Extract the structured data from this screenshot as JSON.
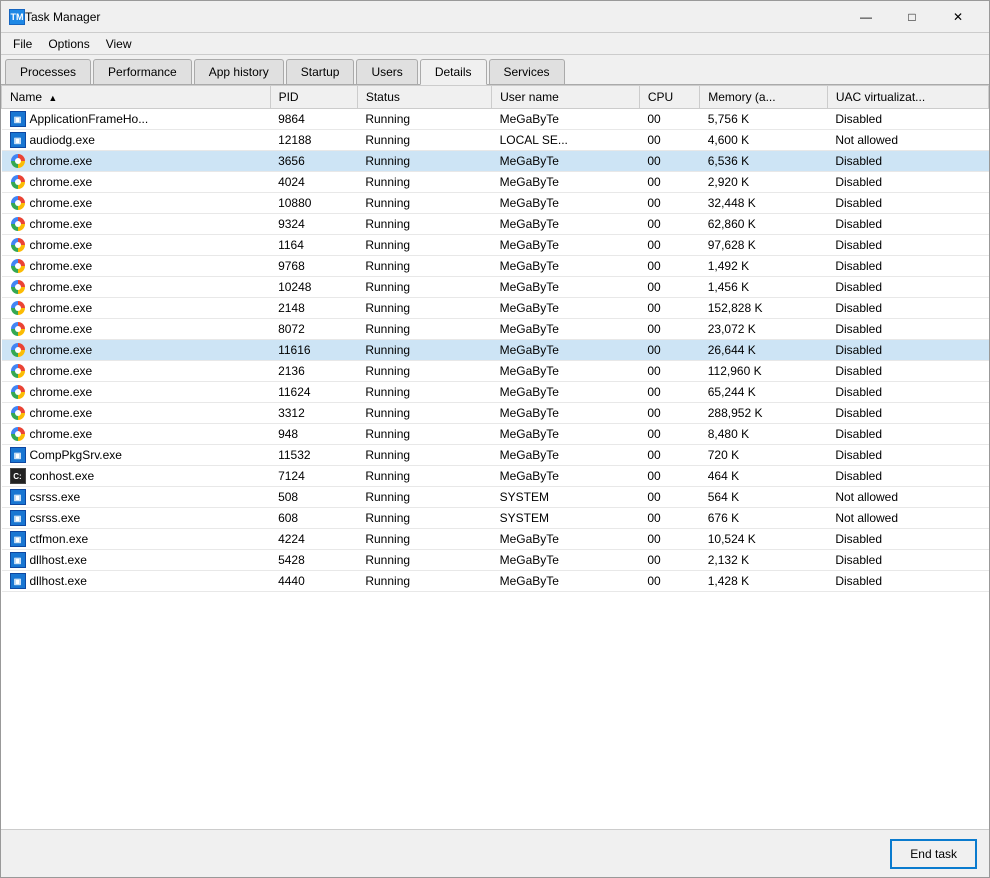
{
  "window": {
    "title": "Task Manager",
    "min_btn": "—",
    "max_btn": "□",
    "close_btn": "✕"
  },
  "menu": {
    "items": [
      "File",
      "Options",
      "View"
    ]
  },
  "tabs": [
    {
      "label": "Processes"
    },
    {
      "label": "Performance"
    },
    {
      "label": "App history"
    },
    {
      "label": "Startup"
    },
    {
      "label": "Users"
    },
    {
      "label": "Details"
    },
    {
      "label": "Services"
    }
  ],
  "active_tab": "Details",
  "table": {
    "columns": [
      {
        "label": "Name",
        "sort": "▲"
      },
      {
        "label": "PID"
      },
      {
        "label": "Status"
      },
      {
        "label": "User name"
      },
      {
        "label": "CPU"
      },
      {
        "label": "Memory (a..."
      },
      {
        "label": "UAC virtualizat..."
      }
    ],
    "rows": [
      {
        "icon": "app",
        "name": "ApplicationFrameHo...",
        "pid": "9864",
        "status": "Running",
        "user": "MeGaByTe",
        "cpu": "00",
        "mem": "5,756 K",
        "uac": "Disabled",
        "selected": false
      },
      {
        "icon": "app",
        "name": "audiodg.exe",
        "pid": "12188",
        "status": "Running",
        "user": "LOCAL SE...",
        "cpu": "00",
        "mem": "4,600 K",
        "uac": "Not allowed",
        "selected": false
      },
      {
        "icon": "chrome",
        "name": "chrome.exe",
        "pid": "3656",
        "status": "Running",
        "user": "MeGaByTe",
        "cpu": "00",
        "mem": "6,536 K",
        "uac": "Disabled",
        "selected": true
      },
      {
        "icon": "chrome",
        "name": "chrome.exe",
        "pid": "4024",
        "status": "Running",
        "user": "MeGaByTe",
        "cpu": "00",
        "mem": "2,920 K",
        "uac": "Disabled",
        "selected": false
      },
      {
        "icon": "chrome",
        "name": "chrome.exe",
        "pid": "10880",
        "status": "Running",
        "user": "MeGaByTe",
        "cpu": "00",
        "mem": "32,448 K",
        "uac": "Disabled",
        "selected": false
      },
      {
        "icon": "chrome",
        "name": "chrome.exe",
        "pid": "9324",
        "status": "Running",
        "user": "MeGaByTe",
        "cpu": "00",
        "mem": "62,860 K",
        "uac": "Disabled",
        "selected": false
      },
      {
        "icon": "chrome",
        "name": "chrome.exe",
        "pid": "1164",
        "status": "Running",
        "user": "MeGaByTe",
        "cpu": "00",
        "mem": "97,628 K",
        "uac": "Disabled",
        "selected": false
      },
      {
        "icon": "chrome",
        "name": "chrome.exe",
        "pid": "9768",
        "status": "Running",
        "user": "MeGaByTe",
        "cpu": "00",
        "mem": "1,492 K",
        "uac": "Disabled",
        "selected": false
      },
      {
        "icon": "chrome",
        "name": "chrome.exe",
        "pid": "10248",
        "status": "Running",
        "user": "MeGaByTe",
        "cpu": "00",
        "mem": "1,456 K",
        "uac": "Disabled",
        "selected": false
      },
      {
        "icon": "chrome",
        "name": "chrome.exe",
        "pid": "2148",
        "status": "Running",
        "user": "MeGaByTe",
        "cpu": "00",
        "mem": "152,828 K",
        "uac": "Disabled",
        "selected": false
      },
      {
        "icon": "chrome",
        "name": "chrome.exe",
        "pid": "8072",
        "status": "Running",
        "user": "MeGaByTe",
        "cpu": "00",
        "mem": "23,072 K",
        "uac": "Disabled",
        "selected": false
      },
      {
        "icon": "chrome",
        "name": "chrome.exe",
        "pid": "11616",
        "status": "Running",
        "user": "MeGaByTe",
        "cpu": "00",
        "mem": "26,644 K",
        "uac": "Disabled",
        "selected": true
      },
      {
        "icon": "chrome",
        "name": "chrome.exe",
        "pid": "2136",
        "status": "Running",
        "user": "MeGaByTe",
        "cpu": "00",
        "mem": "112,960 K",
        "uac": "Disabled",
        "selected": false
      },
      {
        "icon": "chrome",
        "name": "chrome.exe",
        "pid": "11624",
        "status": "Running",
        "user": "MeGaByTe",
        "cpu": "00",
        "mem": "65,244 K",
        "uac": "Disabled",
        "selected": false
      },
      {
        "icon": "chrome",
        "name": "chrome.exe",
        "pid": "3312",
        "status": "Running",
        "user": "MeGaByTe",
        "cpu": "00",
        "mem": "288,952 K",
        "uac": "Disabled",
        "selected": false
      },
      {
        "icon": "chrome",
        "name": "chrome.exe",
        "pid": "948",
        "status": "Running",
        "user": "MeGaByTe",
        "cpu": "00",
        "mem": "8,480 K",
        "uac": "Disabled",
        "selected": false
      },
      {
        "icon": "app",
        "name": "CompPkgSrv.exe",
        "pid": "11532",
        "status": "Running",
        "user": "MeGaByTe",
        "cpu": "00",
        "mem": "720 K",
        "uac": "Disabled",
        "selected": false
      },
      {
        "icon": "cmd",
        "name": "conhost.exe",
        "pid": "7124",
        "status": "Running",
        "user": "MeGaByTe",
        "cpu": "00",
        "mem": "464 K",
        "uac": "Disabled",
        "selected": false
      },
      {
        "icon": "app",
        "name": "csrss.exe",
        "pid": "508",
        "status": "Running",
        "user": "SYSTEM",
        "cpu": "00",
        "mem": "564 K",
        "uac": "Not allowed",
        "selected": false
      },
      {
        "icon": "app",
        "name": "csrss.exe",
        "pid": "608",
        "status": "Running",
        "user": "SYSTEM",
        "cpu": "00",
        "mem": "676 K",
        "uac": "Not allowed",
        "selected": false
      },
      {
        "icon": "app",
        "name": "ctfmon.exe",
        "pid": "4224",
        "status": "Running",
        "user": "MeGaByTe",
        "cpu": "00",
        "mem": "10,524 K",
        "uac": "Disabled",
        "selected": false
      },
      {
        "icon": "app",
        "name": "dllhost.exe",
        "pid": "5428",
        "status": "Running",
        "user": "MeGaByTe",
        "cpu": "00",
        "mem": "2,132 K",
        "uac": "Disabled",
        "selected": false
      },
      {
        "icon": "app",
        "name": "dllhost.exe",
        "pid": "4440",
        "status": "Running",
        "user": "MeGaByTe",
        "cpu": "00",
        "mem": "1,428 K",
        "uac": "Disabled",
        "selected": false
      }
    ]
  },
  "bottom": {
    "end_task_label": "End task"
  }
}
